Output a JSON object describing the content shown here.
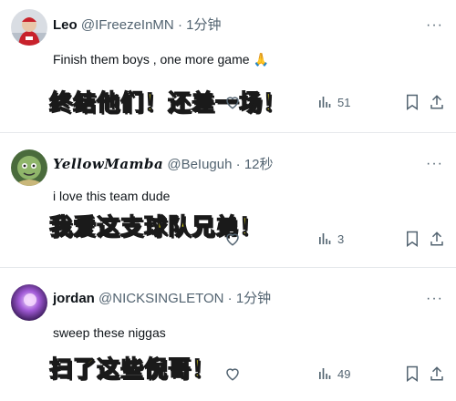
{
  "replies": [
    {
      "name": "Leo",
      "handle": "@IFreezeInMN",
      "dot": "·",
      "time": "1分钟",
      "text": "Finish them boys , one more game",
      "emoji": "🙏",
      "caption": "终结他们！还差一场！",
      "views": "51",
      "avatar_icon": "cartoon-avatar-red-jersey"
    },
    {
      "name": "YellowMamba",
      "handle": "@BeIuguh",
      "dot": "·",
      "time": "12秒",
      "text": "i love this team dude",
      "caption": "我爱这支球队兄弟！",
      "views": "3",
      "avatar_icon": "green-cartoon-avatar"
    },
    {
      "name": "jordan",
      "handle": "@NICKSINGLETON",
      "dot": "·",
      "time": "1分钟",
      "text": "sweep these niggas",
      "caption": "扫了这些倪哥！",
      "views": "49",
      "avatar_icon": "purple-glow-avatar"
    }
  ],
  "more_label": "···",
  "colors": {
    "caption_fill": "#f7ef1a",
    "caption_stroke": "#1a1a1a",
    "secondary_text": "#536471",
    "divider": "#e6e9ec"
  }
}
